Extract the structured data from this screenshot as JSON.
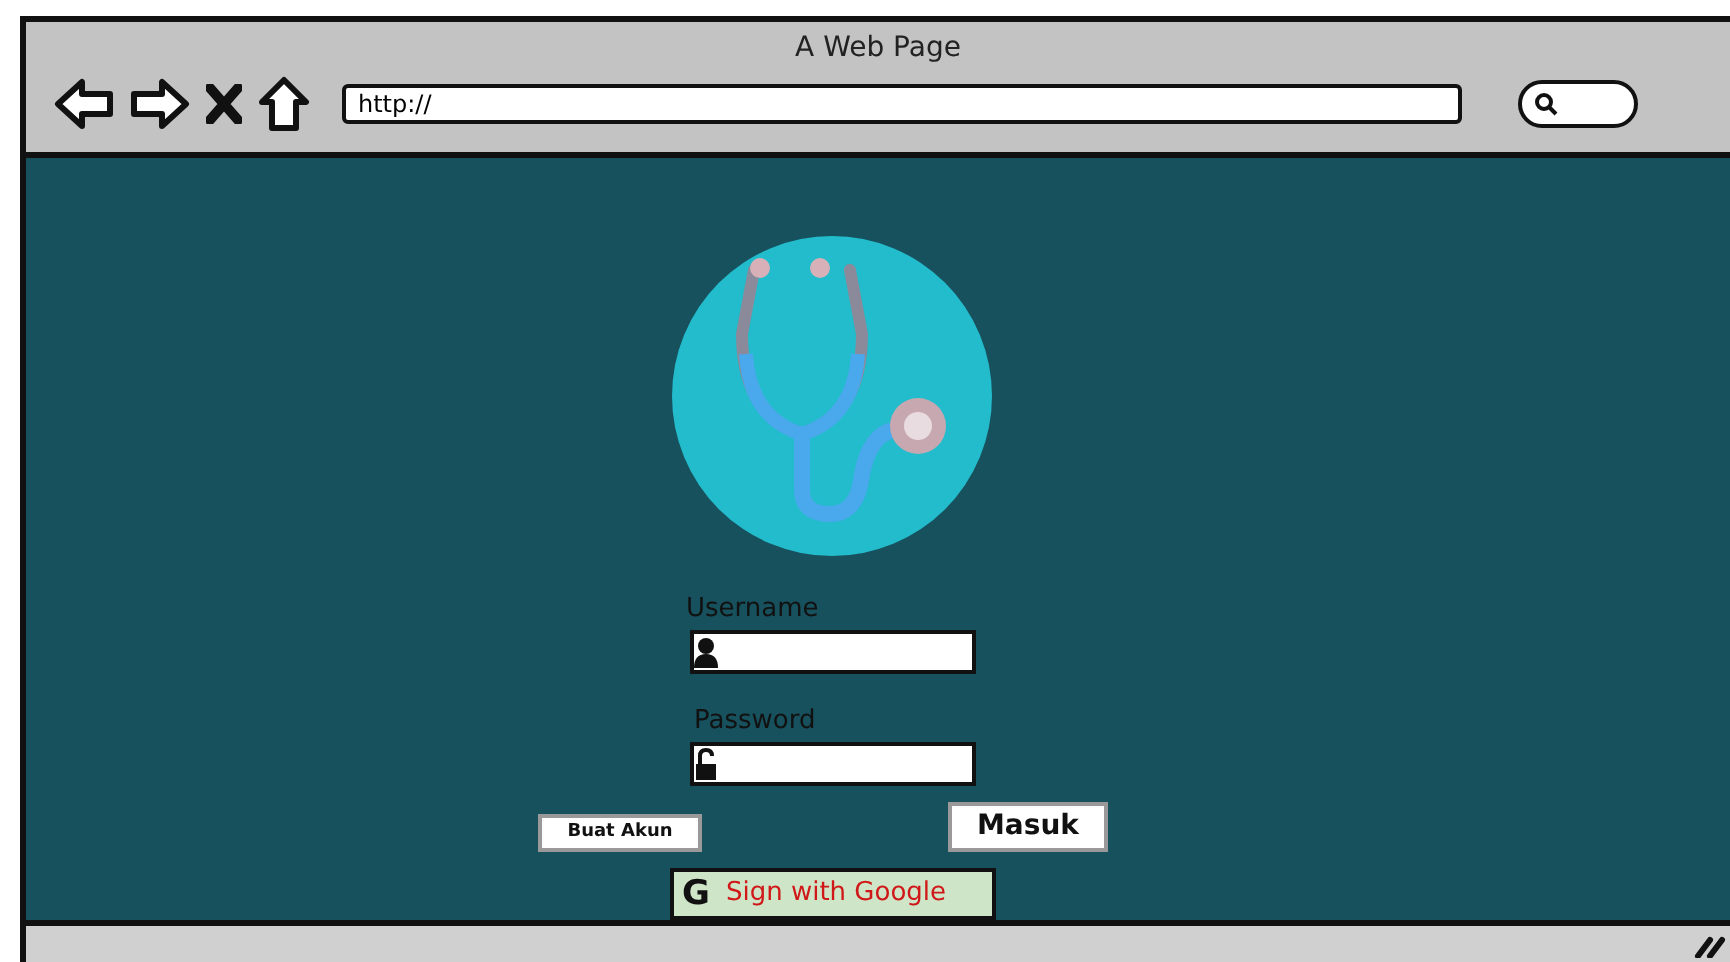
{
  "window": {
    "title": "A Web Page"
  },
  "address_bar": {
    "value": "http://"
  },
  "login": {
    "username_label": "Username",
    "password_label": "Password",
    "buttons": [
      {
        "label": "Buat Akun",
        "kind": "small"
      },
      {
        "label": "Masuk",
        "kind": "primary"
      }
    ],
    "google_button": {
      "glyph": "G",
      "label": "Sign with Google"
    }
  }
}
